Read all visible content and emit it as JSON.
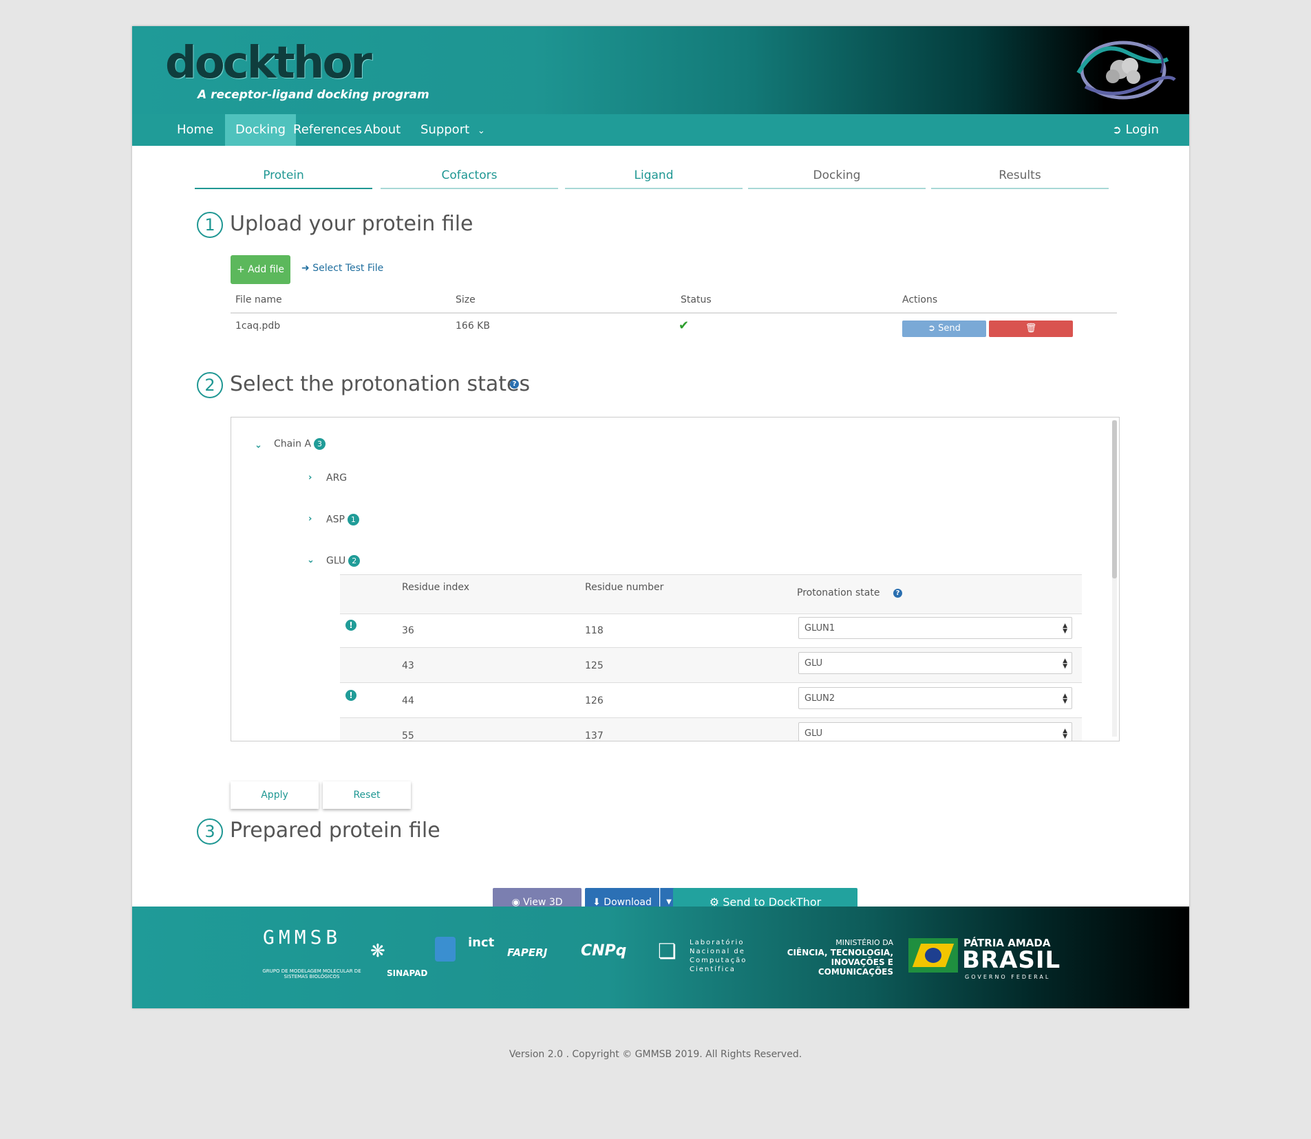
{
  "brand": {
    "title": "dockthor",
    "subtitle": "A receptor-ligand docking program"
  },
  "nav": {
    "items": [
      "Home",
      "Docking",
      "References",
      "About",
      "Support"
    ],
    "active": "Docking",
    "login": "Login"
  },
  "tabs": [
    "Protein",
    "Cofactors",
    "Ligand",
    "Docking",
    "Results"
  ],
  "step1": {
    "number": "1",
    "title": "Upload your protein file",
    "add_file": "Add file",
    "select_test": "Select Test File",
    "columns": [
      "File name",
      "Size",
      "Status",
      "Actions"
    ],
    "file": {
      "name": "1caq.pdb",
      "size": "166 KB"
    },
    "send_label": "Send"
  },
  "step2": {
    "number": "2",
    "title": "Select the protonation states",
    "chain": {
      "label": "Chain A",
      "count": "3"
    },
    "residues": [
      {
        "label": "ARG",
        "count": ""
      },
      {
        "label": "ASP",
        "count": "1"
      },
      {
        "label": "GLU",
        "count": "2"
      }
    ],
    "table_headers": [
      "Residue index",
      "Residue number",
      "Protonation state"
    ],
    "rows": [
      {
        "index": "36",
        "number": "118",
        "state": "GLUN1",
        "warn": true
      },
      {
        "index": "43",
        "number": "125",
        "state": "GLU",
        "warn": false
      },
      {
        "index": "44",
        "number": "126",
        "state": "GLUN2",
        "warn": true
      },
      {
        "index": "55",
        "number": "137",
        "state": "GLU",
        "warn": false
      }
    ],
    "apply": "Apply",
    "reset": "Reset"
  },
  "step3": {
    "number": "3",
    "title": "Prepared protein file",
    "view3d": "View 3D",
    "download": "Download",
    "send_dockthor": "Send to DockThor"
  },
  "footer_logos": {
    "gmmsb": "GMMSB",
    "gmmsb_sub": "GRUPO DE MODELAGEM MOLECULAR DE SISTEMAS BIOLÓGICOS",
    "sinapad": "SINAPAD",
    "inct": "inct",
    "faperj": "FAPERJ",
    "cnpq": "CNPq",
    "lncc": "Laboratório Nacional de Computação Científica",
    "ministerio_top": "MINISTÉRIO DA",
    "ministerio_main": "CIÊNCIA, TECNOLOGIA, INOVAÇÕES E COMUNICAÇÕES",
    "patria": "PÁTRIA AMADA",
    "brasil": "BRASIL",
    "governo": "GOVERNO FEDERAL"
  },
  "copyright": "Version 2.0 . Copyright © GMMSB 2019. All Rights Reserved.",
  "colors": {
    "teal": "#209c98",
    "green": "#5cb85c",
    "red": "#d9534f",
    "blue": "#2b70b5"
  }
}
